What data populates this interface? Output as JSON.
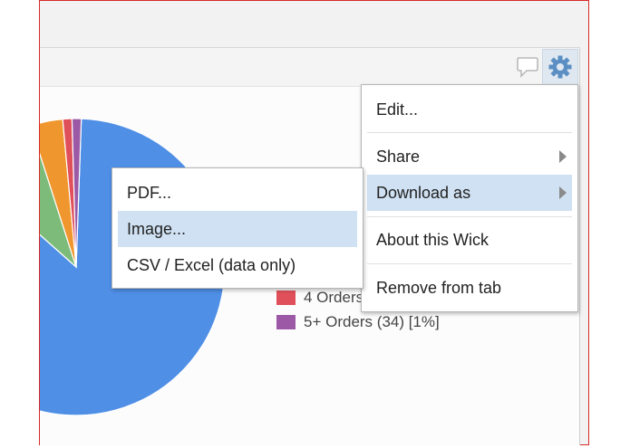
{
  "chart_data": {
    "type": "pie",
    "legend": [
      {
        "label": "4 Orders",
        "color": "#e0505a"
      },
      {
        "label": "5+ Orders (34) [1%]",
        "color": "#9b59a6"
      }
    ],
    "slices": [
      {
        "name": "",
        "value": 86.0,
        "color": "#4f8fe6"
      },
      {
        "name": "",
        "value": 8.5,
        "color": "#7dbb7a"
      },
      {
        "name": "",
        "value": 3.5,
        "color": "#f0962e"
      },
      {
        "name": "4 Orders",
        "value": 1.0,
        "color": "#e0505a"
      },
      {
        "name": "5+ Orders",
        "value": 1.0,
        "color": "#9b59a6"
      }
    ]
  },
  "header": {
    "comment_icon": "comment-icon",
    "gear_icon": "gear-icon",
    "gear_color": "#5b8fc4"
  },
  "main_menu": {
    "items": [
      {
        "label": "Edit..."
      },
      {
        "label": "Share",
        "has_submenu": true
      },
      {
        "label": "Download as",
        "has_submenu": true,
        "active": true
      },
      {
        "label": "About this Wick"
      },
      {
        "label": "Remove from tab"
      }
    ]
  },
  "download_submenu": {
    "items": [
      {
        "label": "PDF..."
      },
      {
        "label": "Image...",
        "active": true
      },
      {
        "label": "CSV / Excel (data only)"
      }
    ]
  }
}
